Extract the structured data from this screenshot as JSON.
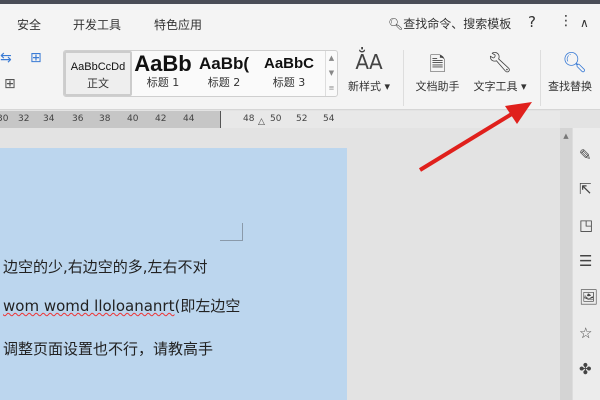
{
  "menu": {
    "tabs": [
      "安全",
      "开发工具",
      "特色应用"
    ],
    "search": "查找命令、搜索模板",
    "help": "?",
    "more": "⋮",
    "collapse": "∧"
  },
  "ribbon": {
    "styles": [
      {
        "sample": "AaBbCcDd",
        "label": "正文"
      },
      {
        "sample": "AaBb",
        "label": "标题 1"
      },
      {
        "sample": "AaBb(",
        "label": "标题 2"
      },
      {
        "sample": "AaBbC",
        "label": "标题 3"
      }
    ],
    "new_style": "新样式",
    "doc_assistant": "文档助手",
    "text_tools": "文字工具",
    "find_replace": "查找替换"
  },
  "ruler": {
    "ticks": [
      "30",
      "32",
      "34",
      "36",
      "38",
      "40",
      "42",
      "44",
      "48",
      "50",
      "52",
      "54"
    ]
  },
  "document": {
    "lines": [
      {
        "text": "边空的少,右边空的多,左右不对"
      },
      {
        "underlined": "wom womd lloloananrt",
        "text": "(即左边空"
      },
      {
        "text": "调整页面设置也不行，请教高手"
      }
    ]
  },
  "sidebar": {
    "icons": [
      "pen-icon",
      "cursor-icon",
      "shapes-icon",
      "sliders-icon",
      "image-icon",
      "star-icon",
      "puzzle-icon"
    ]
  },
  "colors": {
    "page": "#bcd6ee",
    "arrow": "#e0201c"
  }
}
